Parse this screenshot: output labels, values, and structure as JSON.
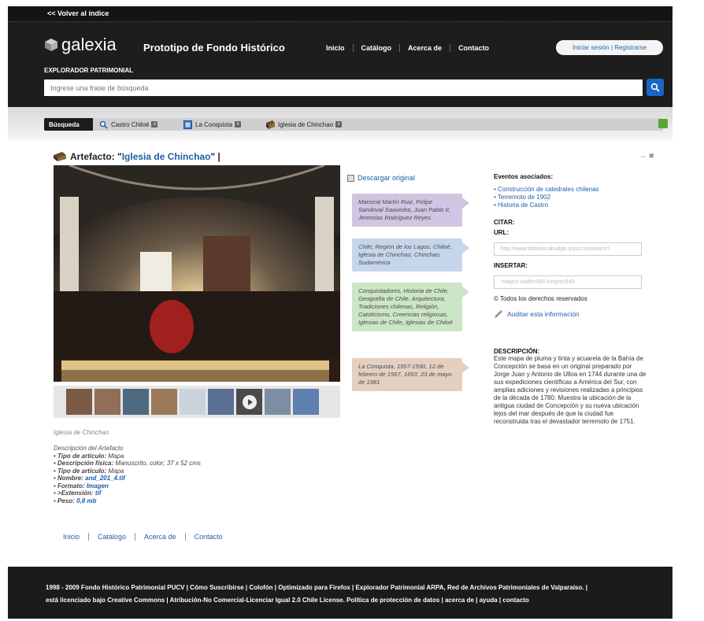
{
  "top": {
    "back_link": "<< Volver al índice"
  },
  "header": {
    "logo_text": "galexia",
    "site_title": "Prototipo de Fondo Histórico",
    "nav": [
      "Inicio",
      "Catálogo",
      "Acerca de",
      "Contacto"
    ],
    "login": "Iniciar sesión | Registrarse",
    "explorer_label": "EXPLORADOR PATRIMONIAL",
    "search_placeholder": "Ingrese una frase de búsqueda"
  },
  "breadcrumb": {
    "search_label": "Búsqueda",
    "items": [
      "Castro Chiloé",
      "La Conquista",
      "Iglesia de Chinchao"
    ]
  },
  "artifact": {
    "prefix": "Artefacto: \"",
    "name": "Iglesia de Chinchao",
    "suffix": "\" |",
    "caption": "Iglesia de Chinchao",
    "desc_heading": "Descripción del Artefacto",
    "fields": [
      {
        "label": "Tipo de artículo:",
        "value": "Mapa",
        "link": false
      },
      {
        "label": "Descripción física:",
        "value": "Manuscrito, color; 37 x 52 cms",
        "link": false
      },
      {
        "label": "Tipo de artículo:",
        "value": "Mapa",
        "link": false
      },
      {
        "label": "Nombre:",
        "value": "and_201_4.tif",
        "link": true
      },
      {
        "label": "Formato:",
        "value": "Imagen",
        "link": true
      },
      {
        "label": ">Extensión:",
        "value": "tif",
        "link": true
      },
      {
        "label": "Peso:",
        "value": "0,8 mb",
        "link": true
      }
    ]
  },
  "tags": {
    "download": "Descargar original",
    "people": "Mariscal Martín Ruiz, Felipe Sandoval Saavedra, Juan Pablo II, Jeremías Rodríguez Reyes",
    "places": "Chile, Región de los Lagos, Chiloé, Iglesia de Chinchao, Chinchao, Sudamérica",
    "topics": "Conquistadores, Historia de Chile, Geografía de Chile, Arquitectura, Tradiciones chilenas, Religión, Catolicismo, Creencias religiosas, Iglesias de Chile, Iglesias de Chiloé",
    "dates": "La Conquista, 1557-1590, 12 de febrero de 1567, 1653, 23 de mayo de 1981"
  },
  "right": {
    "events_heading": "Eventos asociados:",
    "events": [
      "Construcción de catedrales chilenas",
      "Terremoto de 1902",
      "Historia de Castro"
    ],
    "cite_heading": "CITAR:",
    "url_label": "URL:",
    "url_value": "http://www.bibliotecabudge.arpa.com/watch?",
    "embed_label": "INSERTAR:",
    "embed_value": "<object width=560 height=340",
    "rights": "© Todos los derechos reservados",
    "audit": "Auditar esta información",
    "desc_heading": "DESCRIPCIÓN:",
    "description": "Este mapa de pluma y tinta y acuarela de la Bahía de Concepción se basa en un original preparado por Jorge Juan y Antonio de Ulloa en 1744 durante una de sus expediciones científicas a América del Sur, con amplias adiciones y revisiones realizadas a principios de la década de 1780. Muestra la ubicación de la antigua ciudad de Concepción y su nueva ubicación lejos del mar después de que la ciudad fue reconstruida tras el devastador terremoto de 1751."
  },
  "bottom_nav": [
    "Inicio",
    "Catálogo",
    "Acerca de",
    "Contacto"
  ],
  "footer": {
    "line1": "1998 - 2009 Fondo Histórico Patrimonial PUCV | Cómo Suscribirse | Colofón | Optimizado para Firefox | Explorador Patrimonial ARPA, Red de Archivos Patrimoniales de Valparaíso. |",
    "line2": "está licenciado bajo Creative Commons | Atribución-No Comercial-Licenciar Igual 2.0 Chile License. Política de protección de datos | acerca de | ayuda | contacto"
  }
}
